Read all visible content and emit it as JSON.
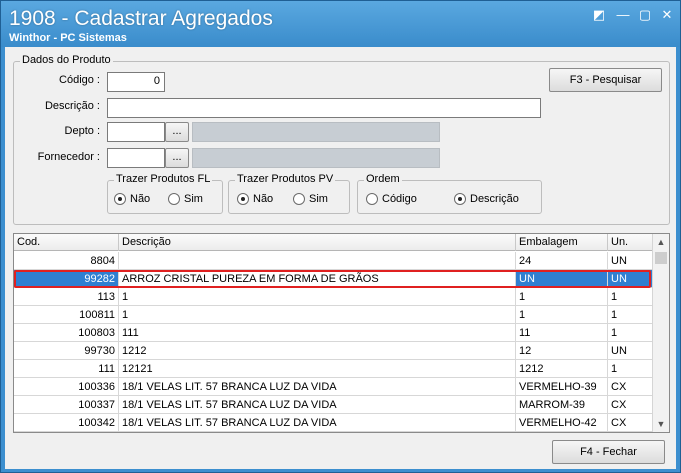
{
  "window": {
    "title": "1908 - Cadastrar Agregados",
    "subtitle": "Winthor - PC Sistemas",
    "controls": {
      "restore": "◩",
      "minimize": "—",
      "maximize": "▢",
      "close": "✕"
    }
  },
  "dados_produto": {
    "legend": "Dados do Produto",
    "codigo_label": "Código :",
    "codigo_value": "0",
    "descricao_label": "Descrição :",
    "descricao_value": "",
    "depto_label": "Depto :",
    "depto_value": "",
    "fornecedor_label": "Fornecedor :",
    "fornecedor_value": "",
    "ellipsis": "...",
    "pesquisar_button": "F3 - Pesquisar"
  },
  "trazer_fl": {
    "legend": "Trazer Produtos FL",
    "options": [
      "Não",
      "Sim"
    ],
    "selected": "Não"
  },
  "trazer_pv": {
    "legend": "Trazer Produtos PV",
    "options": [
      "Não",
      "Sim"
    ],
    "selected": "Não"
  },
  "ordem": {
    "legend": "Ordem",
    "options": [
      "Código",
      "Descrição"
    ],
    "selected": "Descrição"
  },
  "grid": {
    "columns": [
      "Cod.",
      "Descrição",
      "Embalagem",
      "Un."
    ],
    "rows": [
      {
        "cod": "8804",
        "descricao": "",
        "embalagem": "24",
        "un": "UN"
      },
      {
        "cod": "99282",
        "descricao": "ARROZ  CRISTAL PUREZA EM FORMA DE GRÃOS",
        "embalagem": "UN",
        "un": "UN"
      },
      {
        "cod": "113",
        "descricao": "1",
        "embalagem": "1",
        "un": "1"
      },
      {
        "cod": "100811",
        "descricao": "1",
        "embalagem": "1",
        "un": "1"
      },
      {
        "cod": "100803",
        "descricao": "111",
        "embalagem": "11",
        "un": "1"
      },
      {
        "cod": "99730",
        "descricao": "1212",
        "embalagem": "12",
        "un": "UN"
      },
      {
        "cod": "111",
        "descricao": "12121",
        "embalagem": "1212",
        "un": "1"
      },
      {
        "cod": "100336",
        "descricao": "18/1 VELAS LIT. 57 BRANCA LUZ DA VIDA",
        "embalagem": "VERMELHO-39",
        "un": "CX"
      },
      {
        "cod": "100337",
        "descricao": "18/1 VELAS LIT. 57 BRANCA LUZ DA VIDA",
        "embalagem": "MARROM-39",
        "un": "CX"
      },
      {
        "cod": "100342",
        "descricao": "18/1 VELAS LIT. 57 BRANCA LUZ DA VIDA",
        "embalagem": "VERMELHO-42",
        "un": "CX"
      }
    ],
    "selected_row": 1
  },
  "footer": {
    "fechar_button": "F4 - Fechar"
  },
  "colors": {
    "title_bar": "#3a8ccb",
    "selection": "#2f7fd1",
    "highlight_border": "#e02020"
  }
}
